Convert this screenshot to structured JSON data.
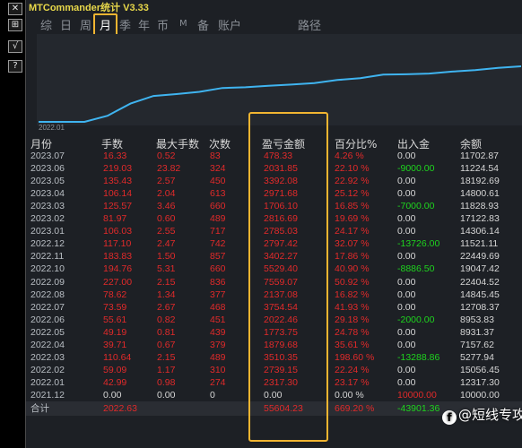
{
  "app": {
    "title": "MTCommander统计 V3.33"
  },
  "leftbar": {
    "buttons": [
      {
        "icon": "close-icon",
        "glyph": "✕"
      },
      {
        "icon": "split-icon",
        "glyph": "⊞"
      },
      {
        "icon": "check-icon",
        "glyph": "√"
      },
      {
        "icon": "help-icon",
        "glyph": "?"
      }
    ]
  },
  "tabs": [
    {
      "label": "综"
    },
    {
      "label": "日"
    },
    {
      "label": "周"
    },
    {
      "label": "月",
      "active": true
    },
    {
      "label": "季"
    },
    {
      "label": "年"
    },
    {
      "label": "币"
    },
    {
      "label": "M"
    },
    {
      "label": "备"
    },
    {
      "label": "账户"
    },
    {
      "label": "路径"
    }
  ],
  "chart": {
    "x_tick": "2022.01",
    "line_color": "#3fb4f0",
    "values": [
      10000,
      10000,
      10000,
      11600,
      14800,
      16800,
      17300,
      17900,
      18900,
      19100,
      19500,
      19800,
      20200,
      21000,
      21500,
      22400,
      22500,
      22700,
      23200,
      23600,
      24200,
      24600
    ]
  },
  "table": {
    "headers": [
      "月份",
      "手数",
      "最大手数",
      "次数",
      "盈亏金额",
      "百分比%",
      "出入金",
      "余额"
    ],
    "rows": [
      [
        "2023.07",
        "16.33",
        "0.52",
        "83",
        "478.33",
        "4.26 %",
        "0.00",
        "11702.87"
      ],
      [
        "2023.06",
        "219.03",
        "23.82",
        "324",
        "2031.85",
        "22.10 %",
        "-9000.00",
        "11224.54"
      ],
      [
        "2023.05",
        "135.43",
        "2.57",
        "450",
        "3392.08",
        "22.92 %",
        "0.00",
        "18192.69"
      ],
      [
        "2023.04",
        "106.14",
        "2.04",
        "613",
        "2971.68",
        "25.12 %",
        "0.00",
        "14800.61"
      ],
      [
        "2023.03",
        "125.57",
        "3.46",
        "660",
        "1706.10",
        "16.85 %",
        "-7000.00",
        "11828.93"
      ],
      [
        "2023.02",
        "81.97",
        "0.60",
        "489",
        "2816.69",
        "19.69 %",
        "0.00",
        "17122.83"
      ],
      [
        "2023.01",
        "106.03",
        "2.55",
        "717",
        "2785.03",
        "24.17 %",
        "0.00",
        "14306.14"
      ],
      [
        "2022.12",
        "117.10",
        "2.47",
        "742",
        "2797.42",
        "32.07 %",
        "-13726.00",
        "11521.11"
      ],
      [
        "2022.11",
        "183.83",
        "1.50",
        "857",
        "3402.27",
        "17.86 %",
        "0.00",
        "22449.69"
      ],
      [
        "2022.10",
        "194.76",
        "5.31",
        "660",
        "5529.40",
        "40.90 %",
        "-8886.50",
        "19047.42"
      ],
      [
        "2022.09",
        "227.00",
        "2.15",
        "836",
        "7559.07",
        "50.92 %",
        "0.00",
        "22404.52"
      ],
      [
        "2022.08",
        "78.62",
        "1.34",
        "377",
        "2137.08",
        "16.82 %",
        "0.00",
        "14845.45"
      ],
      [
        "2022.07",
        "73.59",
        "2.67",
        "468",
        "3754.54",
        "41.93 %",
        "0.00",
        "12708.37"
      ],
      [
        "2022.06",
        "55.61",
        "0.82",
        "451",
        "2022.46",
        "29.18 %",
        "-2000.00",
        "8953.83"
      ],
      [
        "2022.05",
        "49.19",
        "0.81",
        "439",
        "1773.75",
        "24.78 %",
        "0.00",
        "8931.37"
      ],
      [
        "2022.04",
        "39.71",
        "0.67",
        "379",
        "1879.68",
        "35.61 %",
        "0.00",
        "7157.62"
      ],
      [
        "2022.03",
        "110.64",
        "2.15",
        "489",
        "3510.35",
        "198.60 %",
        "-13288.86",
        "5277.94"
      ],
      [
        "2022.02",
        "59.09",
        "1.17",
        "310",
        "2739.15",
        "22.24 %",
        "0.00",
        "15056.45"
      ],
      [
        "2022.01",
        "42.99",
        "0.98",
        "274",
        "2317.30",
        "23.17 %",
        "0.00",
        "12317.30"
      ],
      [
        "2021.12",
        "0.00",
        "0.00",
        "0",
        "0.00",
        "0.00 %",
        "10000.00",
        "10000.00"
      ]
    ],
    "total": [
      "合计",
      "2022.63",
      "",
      "",
      "55604.23",
      "669.20 %",
      "-43901.36",
      ""
    ]
  },
  "watermark": {
    "text": "@短线专攻",
    "icon": "facebook-icon"
  },
  "colors": {
    "accent_highlight": "#f1b531",
    "profit": "#e12a2a",
    "deposit": "#1ed41e",
    "title": "#e8d84a"
  }
}
